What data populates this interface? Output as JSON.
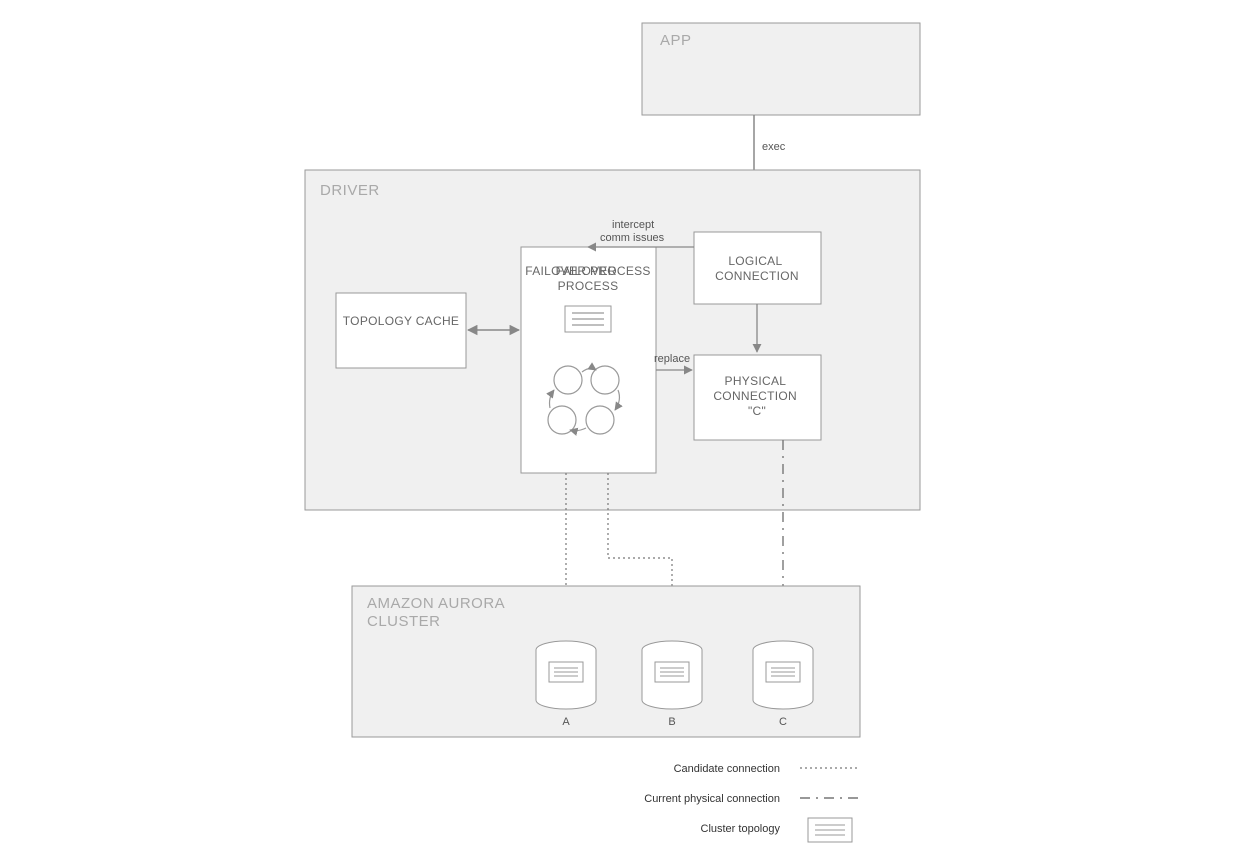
{
  "app": {
    "label": "APP"
  },
  "driver": {
    "label": "DRIVER",
    "topology_cache": "TOPOLOGY CACHE",
    "failover_process": "FAILOVER PROCESS",
    "logical_connection_l1": "LOGICAL",
    "logical_connection_l2": "CONNECTION",
    "physical_connection_l1": "PHYSICAL",
    "physical_connection_l2": "CONNECTION",
    "physical_connection_l3": "\"C\""
  },
  "edges": {
    "exec": "exec",
    "intercept_l1": "intercept",
    "intercept_l2": "comm issues",
    "replace": "replace"
  },
  "cluster": {
    "label_l1": "AMAZON AURORA",
    "label_l2": "CLUSTER",
    "a": "A",
    "b": "B",
    "c": "C"
  },
  "legend": {
    "candidate": "Candidate connection",
    "current": "Current physical connection",
    "topology": "Cluster topology"
  }
}
